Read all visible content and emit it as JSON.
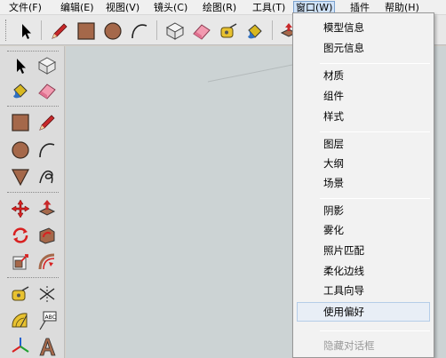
{
  "menubar": {
    "items": [
      {
        "label": "文件(F)"
      },
      {
        "label": "编辑(E)"
      },
      {
        "label": "视图(V)"
      },
      {
        "label": "镜头(C)"
      },
      {
        "label": "绘图(R)"
      },
      {
        "label": "工具(T)"
      },
      {
        "label": "窗口(W)"
      },
      {
        "label": "插件"
      },
      {
        "label": "帮助(H)"
      }
    ]
  },
  "window_menu": {
    "items": [
      {
        "label": "模型信息"
      },
      {
        "label": "图元信息"
      },
      {
        "label": "材质"
      },
      {
        "label": "组件"
      },
      {
        "label": "样式"
      },
      {
        "label": "图层"
      },
      {
        "label": "大纲"
      },
      {
        "label": "场景"
      },
      {
        "label": "阴影"
      },
      {
        "label": "雾化"
      },
      {
        "label": "照片匹配"
      },
      {
        "label": "柔化边线"
      },
      {
        "label": "工具向导"
      },
      {
        "label": "使用偏好"
      },
      {
        "label": "隐藏对话框"
      }
    ]
  },
  "colors": {
    "canvas_background": "#ccd3d4",
    "menu_active_highlight": "#cfe2f8",
    "pencil_red": "#c8282a",
    "shape_brown": "#a5684a"
  },
  "icons": [
    "select-arrow-icon",
    "eraser-icon",
    "paint-bucket-icon",
    "pencil-icon",
    "rectangle-icon",
    "circle-icon",
    "arc-icon",
    "polygon-icon",
    "freehand-icon",
    "move-icon",
    "push-pull-icon",
    "rotate-icon",
    "follow-me-icon",
    "scale-icon",
    "offset-icon",
    "tape-measure-icon",
    "dimension-icon",
    "protractor-icon",
    "text-label-icon",
    "axes-icon",
    "3d-text-icon",
    "make-component-icon",
    "push-pull-toolbar-icon"
  ]
}
